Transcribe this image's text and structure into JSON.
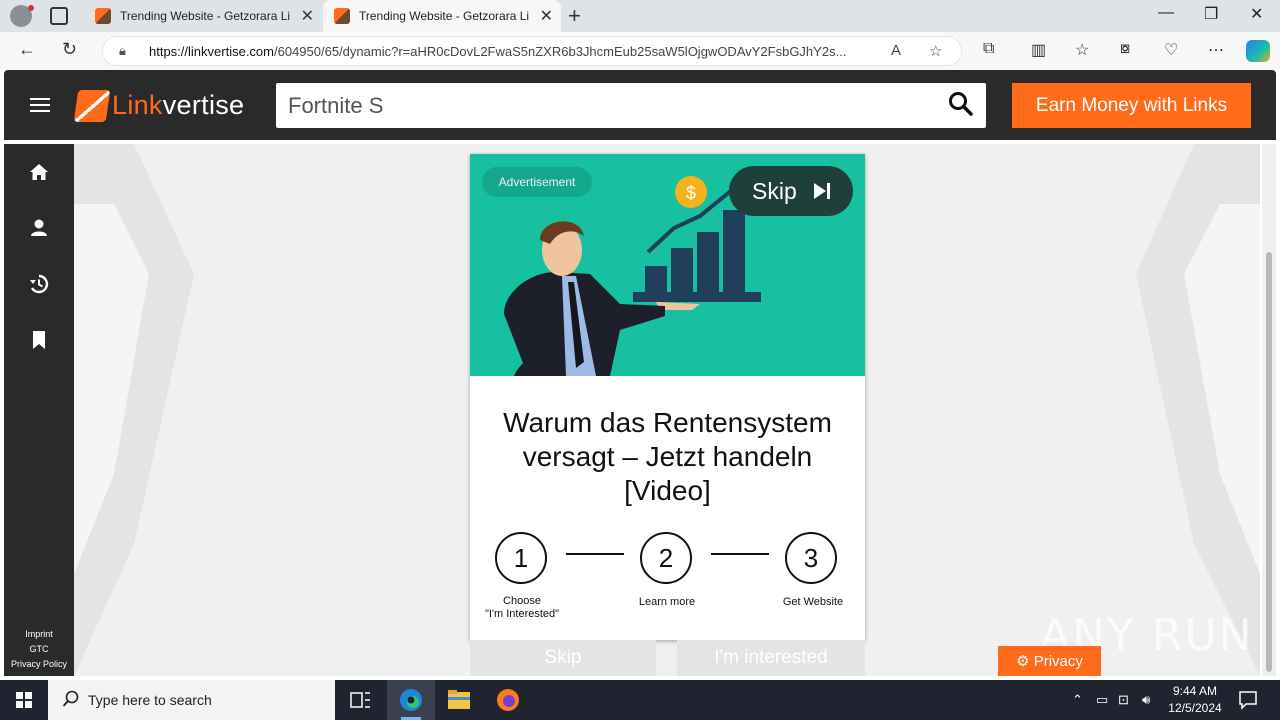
{
  "browser": {
    "tabs": [
      {
        "title": "Trending Website - Getzorara Lin",
        "active": false
      },
      {
        "title": "Trending Website - Getzorara Lin",
        "active": true
      }
    ],
    "url_host": "https://linkvertise.com",
    "url_path": "/604950/65/dynamic?r=aHR0cDovL2FwaS5nZXR6b3JhcmEub25saW5lOjgwODAvY2FsbGJhY2s..."
  },
  "header": {
    "logo_link": "Link",
    "logo_vertise": "vertise",
    "search_value": "Fortnite S",
    "earn_button": "Earn Money with Links"
  },
  "sidebar": {
    "items": [
      "home-icon",
      "user-icon",
      "history-icon",
      "bookmark-icon"
    ],
    "imprint": "Imprint",
    "gtc": "GTC",
    "privacy_policy": "Privacy Policy"
  },
  "ad": {
    "advertisement_label": "Advertisement",
    "skip_label": "Skip",
    "headline": "Warum das Rentensystem versagt – Jetzt handeln [Video]"
  },
  "steps": [
    {
      "number": "1",
      "label_line1": "Choose",
      "label_line2": "\"I'm Interested\""
    },
    {
      "number": "2",
      "label_line1": "Learn more",
      "label_line2": ""
    },
    {
      "number": "3",
      "label_line1": "Get Website",
      "label_line2": ""
    }
  ],
  "bottom_buttons": {
    "skip": "Skip",
    "interested": "I'm interested"
  },
  "privacy_button": "Privacy",
  "watermark": "ANY RUN",
  "taskbar": {
    "search_placeholder": "Type here to search",
    "time": "9:44 AM",
    "date": "12/5/2024"
  },
  "colors": {
    "accent": "#ff6b1a",
    "header_bg": "#2a2a2a",
    "banner_bg": "#16c0a0"
  }
}
